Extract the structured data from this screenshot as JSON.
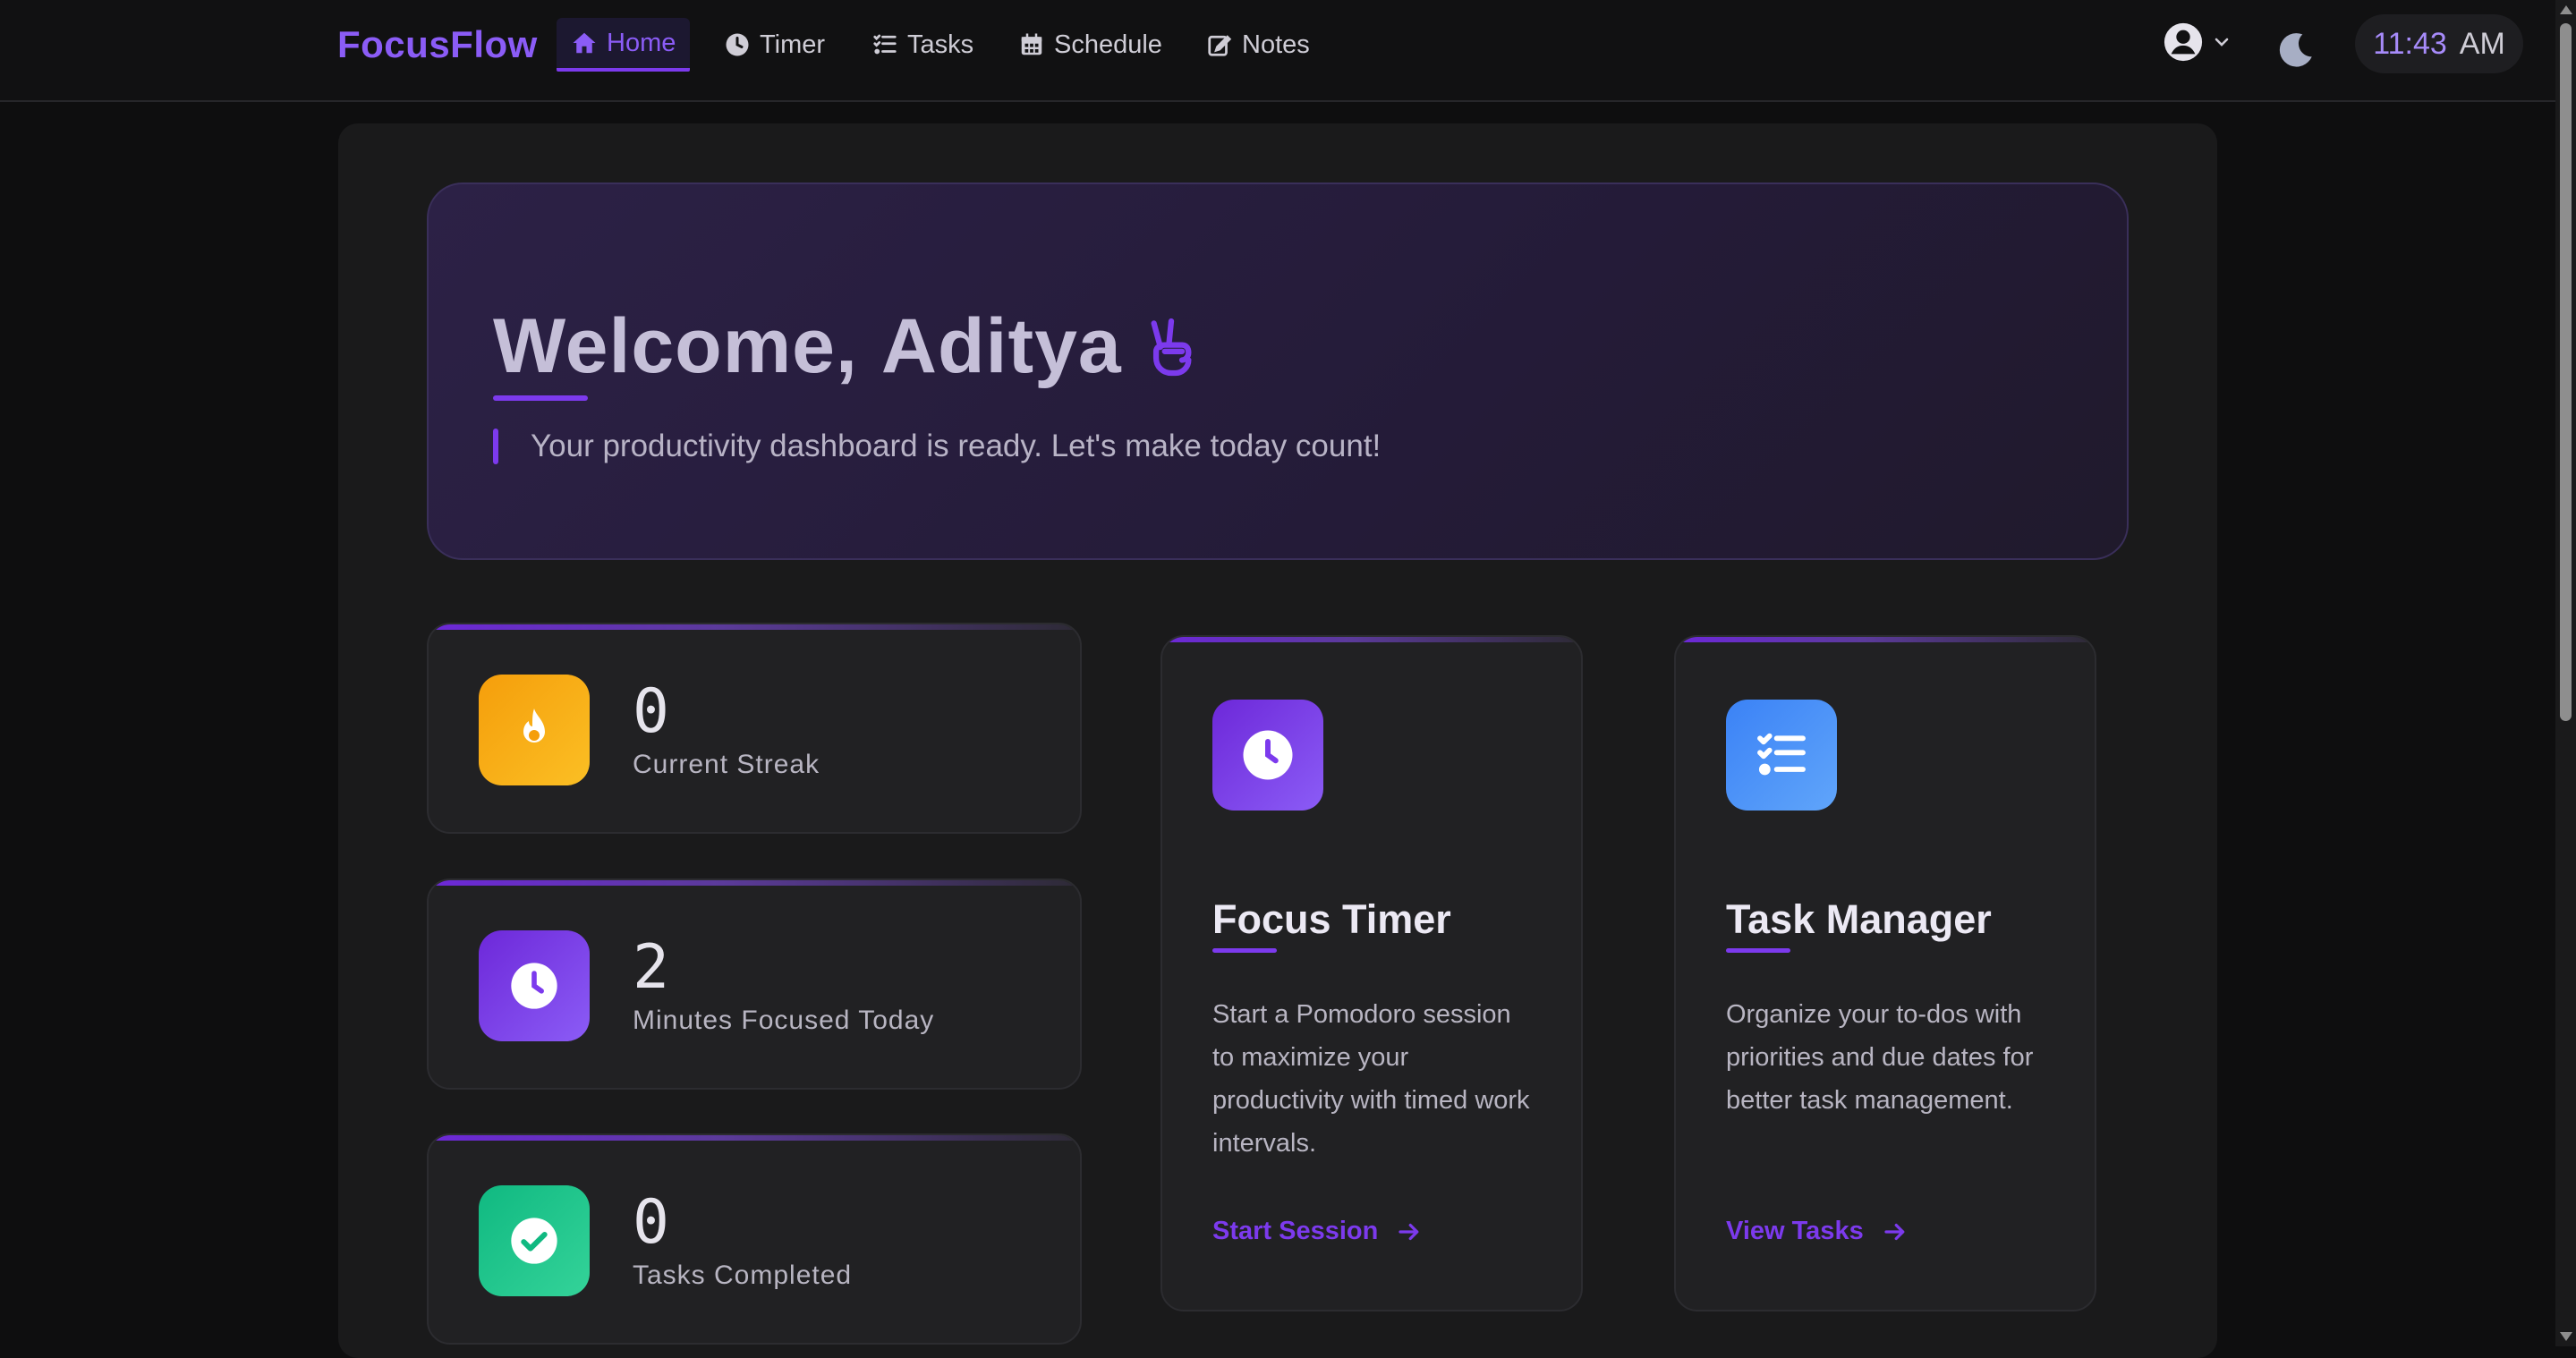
{
  "brand": "FocusFlow",
  "nav": [
    {
      "label": "Home",
      "icon": "home-icon",
      "active": true
    },
    {
      "label": "Timer",
      "icon": "clock-icon",
      "active": false
    },
    {
      "label": "Tasks",
      "icon": "list-check-icon",
      "active": false
    },
    {
      "label": "Schedule",
      "icon": "calendar-icon",
      "active": false
    },
    {
      "label": "Notes",
      "icon": "edit-icon",
      "active": false
    }
  ],
  "header": {
    "user_icon": "user-circle-icon",
    "theme_icon": "moon-icon",
    "clock_time": "11:43",
    "clock_ampm": "AM"
  },
  "hero": {
    "welcome": "Welcome,",
    "name": "Aditya",
    "emoji_icon": "peace-hand-icon",
    "subtitle": "Your productivity dashboard is ready. Let's make today count!"
  },
  "stats": [
    {
      "value": "0",
      "label": "Current Streak",
      "icon": "fire-icon",
      "color": "#f59e0b"
    },
    {
      "value": "2",
      "label": "Minutes Focused Today",
      "icon": "clock-icon",
      "color": "#7c3aed"
    },
    {
      "value": "0",
      "label": "Tasks Completed",
      "icon": "check-circle-icon",
      "color": "#10b981"
    }
  ],
  "features": [
    {
      "title": "Focus Timer",
      "description": "Start a Pomodoro session to maximize your productivity with timed work intervals.",
      "link": "Start Session",
      "icon": "clock-icon",
      "color": "#7c3aed"
    },
    {
      "title": "Task Manager",
      "description": "Organize your to-dos with priorities and due dates for better task management.",
      "link": "View Tasks",
      "icon": "list-icon",
      "color": "#3b82f6"
    }
  ],
  "colors": {
    "accent": "#7c3aed",
    "background": "#0e0e0f",
    "card": "#212123"
  }
}
